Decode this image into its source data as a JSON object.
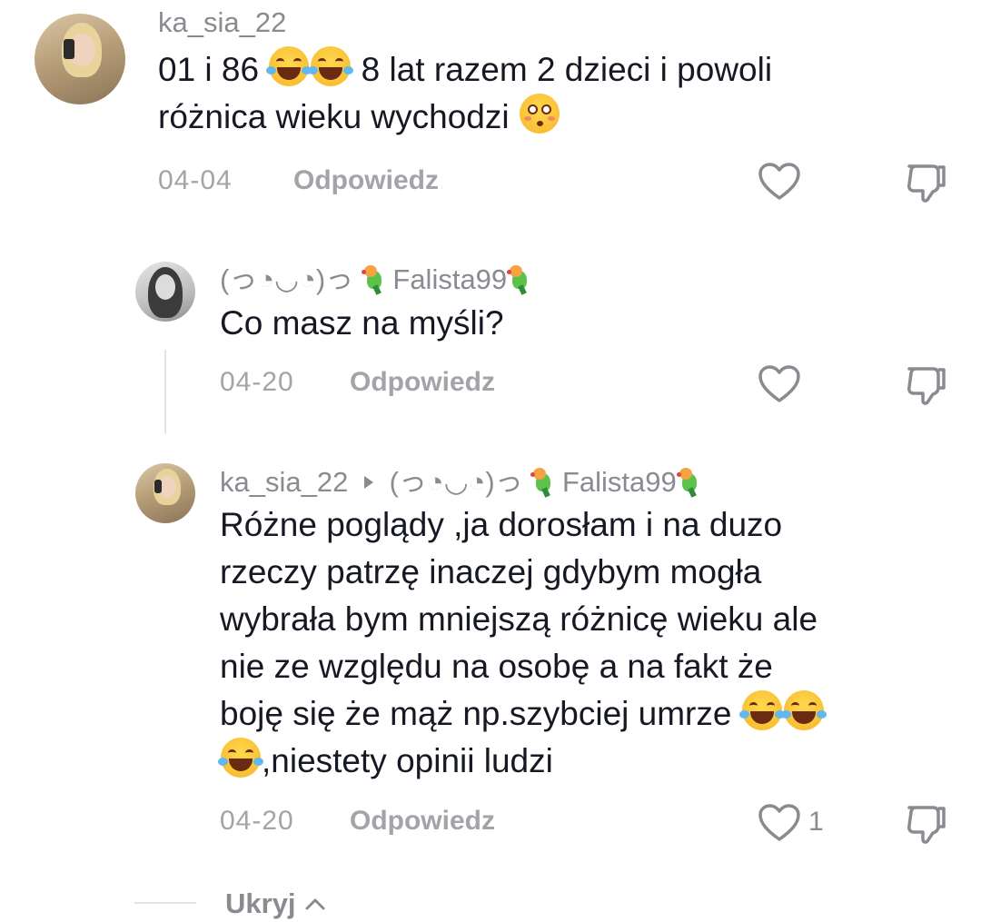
{
  "comments": [
    {
      "username": "ka_sia_22",
      "text_line1_a": "01 i 86 ",
      "text_line1_b": " 8 lat razem 2 dzieci i powoli",
      "text_line2": "różnica wieku wychodzi ",
      "date": "04-04",
      "reply_label": "Odpowiedz",
      "like_count": ""
    },
    {
      "username_prefix": "(っ◔◡◔)っ ",
      "username": " Falista99",
      "text": "Co masz na myśli?",
      "date": "04-20",
      "reply_label": "Odpowiedz",
      "like_count": ""
    },
    {
      "username": "ka_sia_22",
      "reply_to_prefix": "(っ◔◡◔)っ ",
      "reply_to_name": " Falista99",
      "lines": [
        "Różne poglądy ,ja dorosłam i na duzo",
        "rzeczy patrzę inaczej gdybym mogła",
        "wybrała bym mniejszą różnicę wieku ale",
        "nie ze względu na osobę a na fakt że",
        "boję się że mąż np.szybciej umrze "
      ],
      "last_line": ",niestety opinii ludzi",
      "date": "04-20",
      "reply_label": "Odpowiedz",
      "like_count": "1"
    }
  ],
  "hide_label": "Ukryj",
  "icons": {
    "like": "heart-outline-icon",
    "dislike": "thumbs-down-outline-icon",
    "emoji_laugh": "face-with-tears-of-joy",
    "emoji_flushed": "flushed-face",
    "parrot": "parrot-emoji",
    "reply_arrow": "caret-right-icon",
    "chevron": "chevron-up-icon"
  },
  "colors": {
    "text_primary": "#161823",
    "text_secondary": "#8a8b91",
    "text_tertiary": "#a3a4a8"
  }
}
